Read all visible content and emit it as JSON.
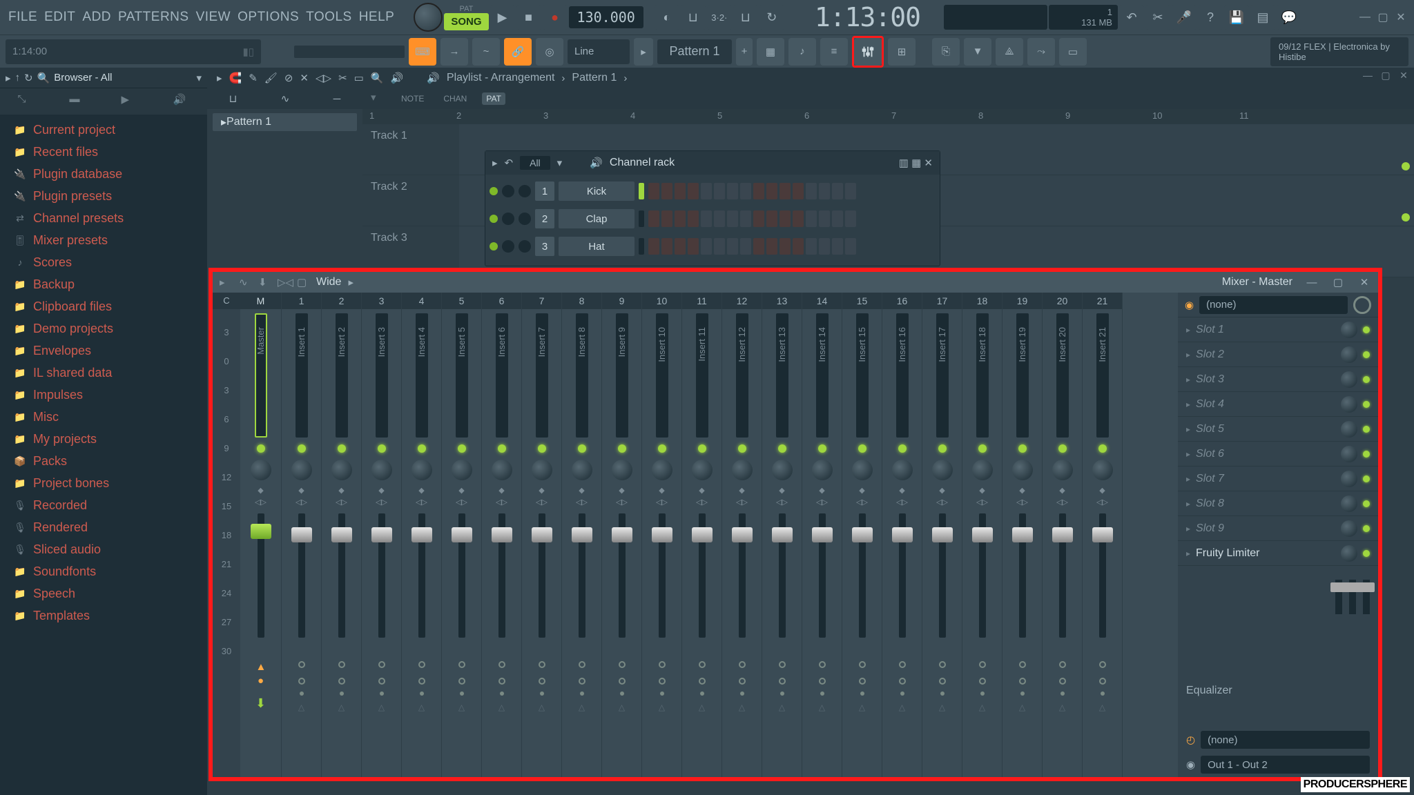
{
  "menu": {
    "items": [
      "FILE",
      "EDIT",
      "ADD",
      "PATTERNS",
      "VIEW",
      "OPTIONS",
      "TOOLS",
      "HELP"
    ]
  },
  "transport": {
    "mode_label": "SONG",
    "pat_label": "PAT",
    "tempo": "130.000",
    "time": "1:13:00",
    "cpu": "1",
    "mem": "131 MB"
  },
  "hint_time": "1:14:00",
  "toolbar": {
    "snap": "Line",
    "pattern": "Pattern 1",
    "flex_line1": "09/12  FLEX | Electronica by",
    "flex_line2": "Histibe"
  },
  "browser": {
    "title": "Browser - All",
    "items": [
      {
        "label": "Current project",
        "icon": "📁"
      },
      {
        "label": "Recent files",
        "icon": "📁"
      },
      {
        "label": "Plugin database",
        "icon": "🔌"
      },
      {
        "label": "Plugin presets",
        "icon": "🔌"
      },
      {
        "label": "Channel presets",
        "icon": "⇄"
      },
      {
        "label": "Mixer presets",
        "icon": "🎚"
      },
      {
        "label": "Scores",
        "icon": "♪"
      },
      {
        "label": "Backup",
        "icon": "📁"
      },
      {
        "label": "Clipboard files",
        "icon": "📁"
      },
      {
        "label": "Demo projects",
        "icon": "📁"
      },
      {
        "label": "Envelopes",
        "icon": "📁"
      },
      {
        "label": "IL shared data",
        "icon": "📁"
      },
      {
        "label": "Impulses",
        "icon": "📁"
      },
      {
        "label": "Misc",
        "icon": "📁"
      },
      {
        "label": "My projects",
        "icon": "📁"
      },
      {
        "label": "Packs",
        "icon": "📦"
      },
      {
        "label": "Project bones",
        "icon": "📁"
      },
      {
        "label": "Recorded",
        "icon": "🎙"
      },
      {
        "label": "Rendered",
        "icon": "🎙"
      },
      {
        "label": "Sliced audio",
        "icon": "🎙"
      },
      {
        "label": "Soundfonts",
        "icon": "📁"
      },
      {
        "label": "Speech",
        "icon": "📁"
      },
      {
        "label": "Templates",
        "icon": "📁"
      }
    ]
  },
  "playlist": {
    "crumb1": "Playlist - Arrangement",
    "crumb2": "Pattern 1",
    "pattern_item": "Pattern 1",
    "tracks": [
      "Track 1",
      "Track 2",
      "Track 3"
    ],
    "tabs": [
      "NOTE",
      "CHAN",
      "PAT"
    ],
    "bars": [
      "1",
      "2",
      "3",
      "4",
      "5",
      "6",
      "7",
      "8",
      "9",
      "10",
      "11"
    ]
  },
  "channel_rack": {
    "title": "Channel rack",
    "filter": "All",
    "channels": [
      {
        "num": "1",
        "name": "Kick"
      },
      {
        "num": "2",
        "name": "Clap"
      },
      {
        "num": "3",
        "name": "Hat"
      }
    ]
  },
  "mixer": {
    "layout": "Wide",
    "title": "Mixer - Master",
    "db_scale": [
      "3",
      "0",
      "3",
      "6",
      "9",
      "12",
      "15",
      "18",
      "21",
      "24",
      "27",
      "30"
    ],
    "strips": [
      {
        "label": "C",
        "name": ""
      },
      {
        "label": "M",
        "name": "Master",
        "master": true,
        "current": true
      },
      {
        "label": "1",
        "name": "Insert 1"
      },
      {
        "label": "2",
        "name": "Insert 2"
      },
      {
        "label": "3",
        "name": "Insert 3"
      },
      {
        "label": "4",
        "name": "Insert 4"
      },
      {
        "label": "5",
        "name": "Insert 5"
      },
      {
        "label": "6",
        "name": "Insert 6"
      },
      {
        "label": "7",
        "name": "Insert 7"
      },
      {
        "label": "8",
        "name": "Insert 8"
      },
      {
        "label": "9",
        "name": "Insert 9"
      },
      {
        "label": "10",
        "name": "Insert 10"
      },
      {
        "label": "11",
        "name": "Insert 11"
      },
      {
        "label": "12",
        "name": "Insert 12"
      },
      {
        "label": "13",
        "name": "Insert 13"
      },
      {
        "label": "14",
        "name": "Insert 14"
      },
      {
        "label": "15",
        "name": "Insert 15"
      },
      {
        "label": "16",
        "name": "Insert 16"
      },
      {
        "label": "17",
        "name": "Insert 17"
      },
      {
        "label": "18",
        "name": "Insert 18"
      },
      {
        "label": "19",
        "name": "Insert 19"
      },
      {
        "label": "20",
        "name": "Insert 20"
      },
      {
        "label": "21",
        "name": "Insert 21"
      }
    ],
    "fx": {
      "input": "(none)",
      "slots": [
        "Slot 1",
        "Slot 2",
        "Slot 3",
        "Slot 4",
        "Slot 5",
        "Slot 6",
        "Slot 7",
        "Slot 8",
        "Slot 9"
      ],
      "active_slot": "Fruity Limiter",
      "eq_label": "Equalizer",
      "time_sel": "(none)",
      "output": "Out 1 - Out 2"
    }
  },
  "watermark": "PRODUCERSPHERE"
}
